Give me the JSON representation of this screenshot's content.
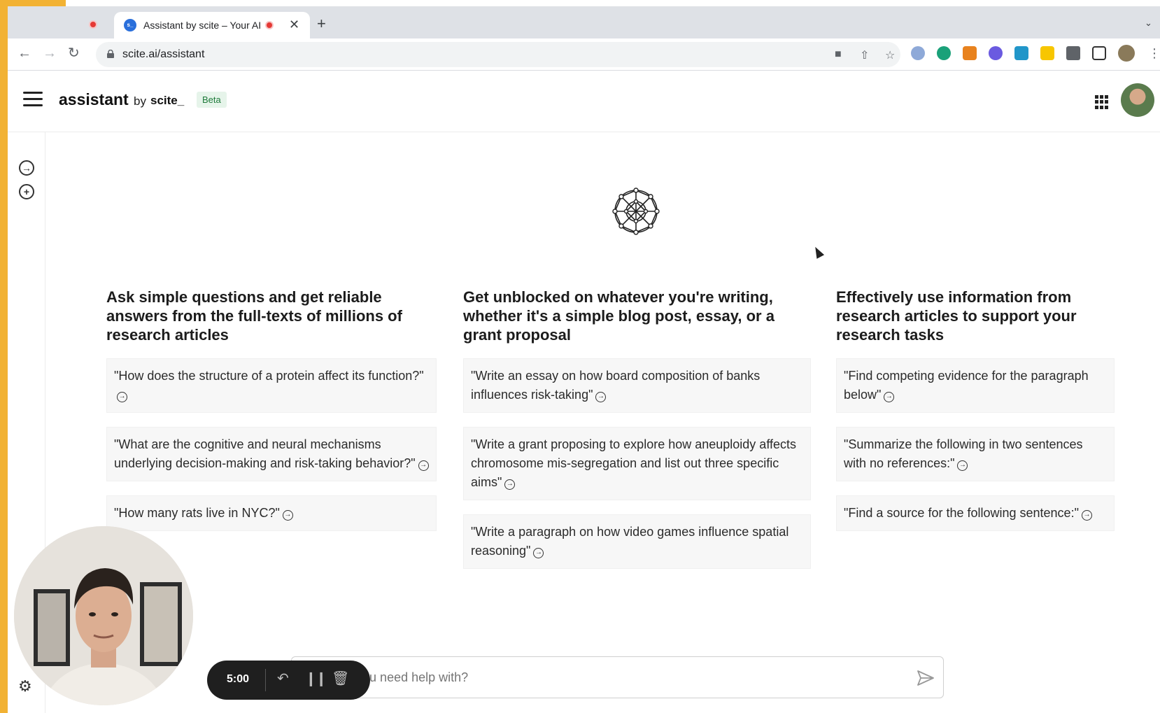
{
  "browser": {
    "active_tab_title": "Assistant by scite – Your AI",
    "url": "scite.ai/assistant",
    "new_tab_glyph": "+",
    "close_glyph": "✕"
  },
  "app": {
    "brand": "assistant",
    "by": "by",
    "company": "scite_",
    "badge": "Beta"
  },
  "columns": [
    {
      "heading": "Ask simple questions and get reliable answers from the full-texts of millions of research articles",
      "prompts": [
        "\"How does the structure of a protein affect its function?\"",
        "\"What are the cognitive and neural mechanisms underlying decision-making and risk-taking behavior?\"",
        "\"How many rats live in NYC?\""
      ]
    },
    {
      "heading": "Get unblocked on whatever you're writing, whether it's a simple blog post, essay, or a grant proposal",
      "prompts": [
        "\"Write an essay on how board composition of banks influences risk-taking\"",
        "\"Write a grant proposing to explore how aneuploidy affects chromosome mis-segregation and list out three specific aims\"",
        "\"Write a paragraph on how video games influence spatial reasoning\""
      ]
    },
    {
      "heading": "Effectively use information from research articles to support your research tasks",
      "prompts": [
        "\"Find competing evidence for the paragraph below\"",
        "\"Summarize the following in two sentences with no references:\"",
        "\"Find a source for the following sentence:\""
      ]
    }
  ],
  "chat": {
    "placeholder": "What do you need help with?"
  },
  "recorder": {
    "time": "5:00"
  },
  "icons": {
    "hamburger": "menu-icon",
    "apps": "apps-grid-icon",
    "rail_open": "arrow-circle-right-icon",
    "rail_new": "plus-circle-icon",
    "settings": "gear-icon",
    "send": "send-icon"
  },
  "colors": {
    "badge_bg": "#e6f4ea",
    "badge_text": "#1e7a3a",
    "frame_accent": "#f2b234",
    "recording": "#e53935"
  }
}
